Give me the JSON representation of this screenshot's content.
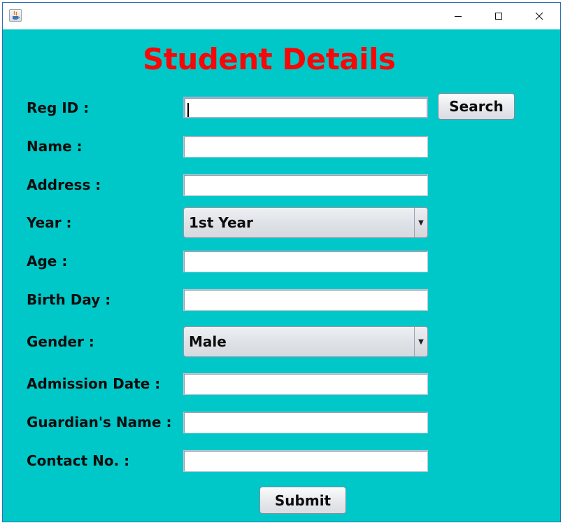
{
  "window": {
    "title": "",
    "controls": {
      "minimize": "minimize-icon",
      "maximize": "maximize-icon",
      "close": "close-icon"
    }
  },
  "form": {
    "heading": "Student Details",
    "fields": [
      {
        "label": "Reg ID :",
        "value": ""
      },
      {
        "label": "Name :",
        "value": ""
      },
      {
        "label": "Address :",
        "value": ""
      },
      {
        "label": "Year :",
        "selected": "1st Year"
      },
      {
        "label": "Age :",
        "value": ""
      },
      {
        "label": "Birth Day :",
        "value": ""
      },
      {
        "label": "Gender :",
        "selected": "Male"
      },
      {
        "label": "Admission Date :",
        "value": ""
      },
      {
        "label": "Guardian's Name :",
        "value": ""
      },
      {
        "label": "Contact No. :",
        "value": ""
      }
    ],
    "search_label": "Search",
    "submit_label": "Submit"
  },
  "colors": {
    "background": "#00c8c8",
    "heading": "#f70707"
  }
}
